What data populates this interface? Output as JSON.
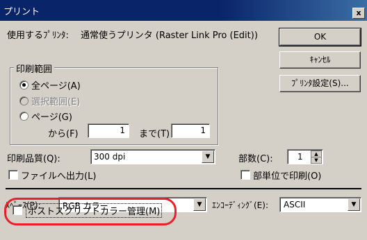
{
  "window": {
    "title": "プリント",
    "close": "x"
  },
  "printer": {
    "label": "使用するﾌﾟﾘﾝﾀ:",
    "name": "通常使うプリンタ (Raster Link Pro (Edit))"
  },
  "buttons": {
    "ok": "OK",
    "cancel": "ｷｬﾝｾﾙ",
    "printer_setup": "ﾌﾟﾘﾝﾀ設定(S)..."
  },
  "range": {
    "title": "印刷範囲",
    "all": "全ページ(A)",
    "selection": "選択範囲(E)",
    "pages": "ページ(G)",
    "from_label": "から(F)",
    "from_value": "1",
    "to_label": "まで(T)",
    "to_value": "1"
  },
  "quality": {
    "label": "印刷品質(Q):",
    "value": "300 dpi"
  },
  "copies": {
    "label": "部数(C):",
    "value": "1"
  },
  "print_to_file": "ファイルへ出力(L)",
  "collate": "部単位で印刷(O)",
  "space": {
    "label": "ｽﾍﾟｰｽ(P):",
    "value": "RGB カラー"
  },
  "encoding": {
    "label": "ｴﾝｺｰﾃﾞｨﾝｸﾞ(E):",
    "value": "ASCII"
  },
  "postscript_color": "ポストスクリプトカラー管理(M)",
  "icons": {
    "dropdown": "▼",
    "spin_up": "▲",
    "spin_down": "▼"
  },
  "colors": {
    "titlebar": "#0a246a",
    "highlight_ring": "#e8202a",
    "face": "#d4d0c8"
  }
}
